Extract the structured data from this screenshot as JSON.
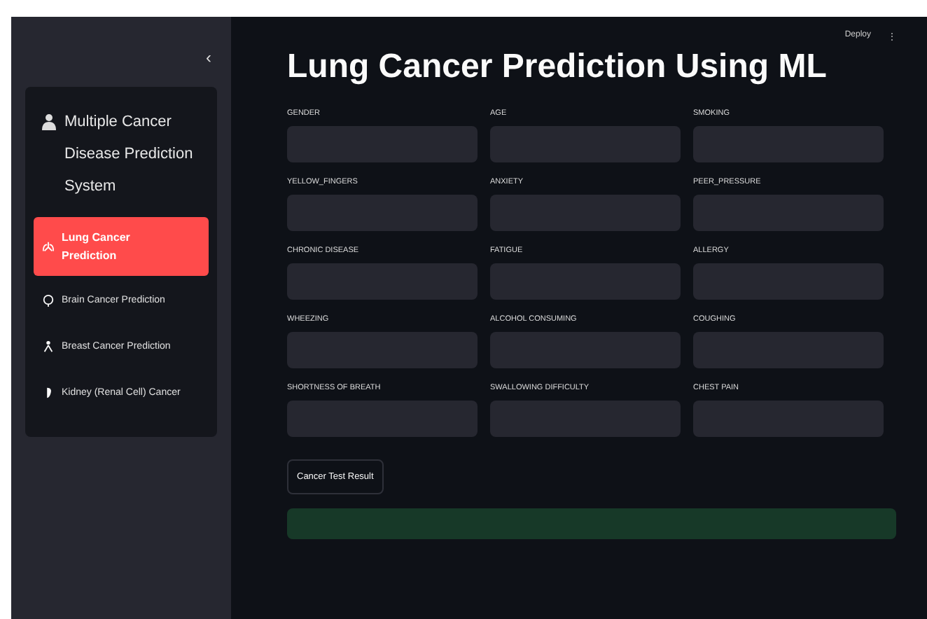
{
  "sidebar": {
    "collapse_icon": "‹",
    "title": "Multiple Cancer Disease Prediction System",
    "items": [
      {
        "label": "Lung Cancer Prediction",
        "selected": true
      },
      {
        "label": "Brain Cancer Prediction",
        "selected": false
      },
      {
        "label": "Breast Cancer Prediction",
        "selected": false
      },
      {
        "label": "Kidney (Renal Cell) Cancer",
        "selected": false
      }
    ]
  },
  "header": {
    "deploy": "Deploy",
    "menu": "⋮"
  },
  "main": {
    "title": "Lung Cancer Prediction Using ML",
    "fields": [
      {
        "label": "GENDER"
      },
      {
        "label": "AGE"
      },
      {
        "label": "SMOKING"
      },
      {
        "label": "YELLOW_FINGERS"
      },
      {
        "label": "ANXIETY"
      },
      {
        "label": "PEER_PRESSURE"
      },
      {
        "label": "CHRONIC DISEASE"
      },
      {
        "label": "FATIGUE"
      },
      {
        "label": "ALLERGY"
      },
      {
        "label": "WHEEZING"
      },
      {
        "label": "ALCOHOL CONSUMING"
      },
      {
        "label": "COUGHING"
      },
      {
        "label": "SHORTNESS OF BREATH"
      },
      {
        "label": "SWALLOWING DIFFICULTY"
      },
      {
        "label": "CHEST PAIN"
      }
    ],
    "button": "Cancer Test Result"
  }
}
